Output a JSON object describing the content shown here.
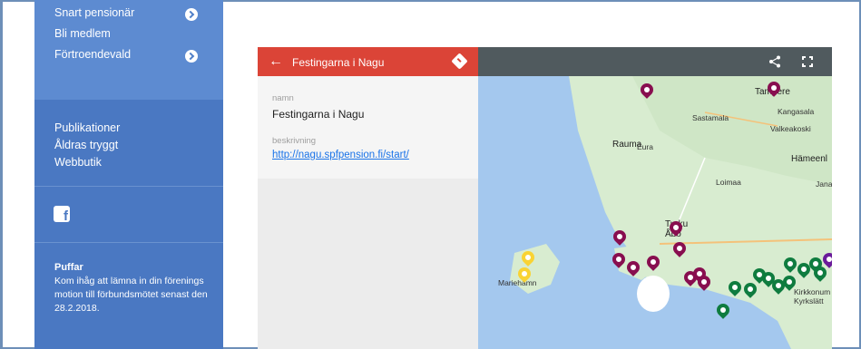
{
  "sidebar": {
    "top_items": [
      {
        "label": "Snart pensionär",
        "has_chevron": true
      },
      {
        "label": "Bli medlem",
        "has_chevron": false
      },
      {
        "label": "Förtroendevald",
        "has_chevron": true
      }
    ],
    "links": [
      "Publikationer",
      "Åldras tryggt",
      "Webbutik"
    ],
    "social_icon": "facebook-icon",
    "puffar": {
      "title": "Puffar",
      "text": "Kom ihåg att lämna in din förenings motion till förbundsmötet senast den 28.2.2018."
    }
  },
  "map_widget": {
    "header_title": "Festingarna i Nagu",
    "fields": [
      {
        "label": "namn",
        "value": "Festingarna i Nagu"
      },
      {
        "label": "beskrivning",
        "value": "http://nagu.spfpension.fi/start/"
      }
    ],
    "icons": [
      "back-arrow-icon",
      "directions-icon",
      "share-icon",
      "fullscreen-icon"
    ],
    "map_labels": [
      {
        "text": "Tampere"
      },
      {
        "text": "Kangasala"
      },
      {
        "text": "Sastamala"
      },
      {
        "text": "Valkeakoski"
      },
      {
        "text": "Rauma"
      },
      {
        "text": "Eura"
      },
      {
        "text": "Hämeenl"
      },
      {
        "text": "Loimaa"
      },
      {
        "text": "Jana"
      },
      {
        "text": "Turku Åbo"
      },
      {
        "text": "Mariehamn"
      },
      {
        "text": "Kirkkonum Kyrkslätt"
      }
    ],
    "colors": {
      "header_red": "#db4437",
      "pin_purple": "#880e4f",
      "pin_green": "#0f7c3f",
      "pin_yellow": "#f9d333",
      "map_water": "#a4c8ee",
      "map_land": "#d8ecd0"
    }
  }
}
